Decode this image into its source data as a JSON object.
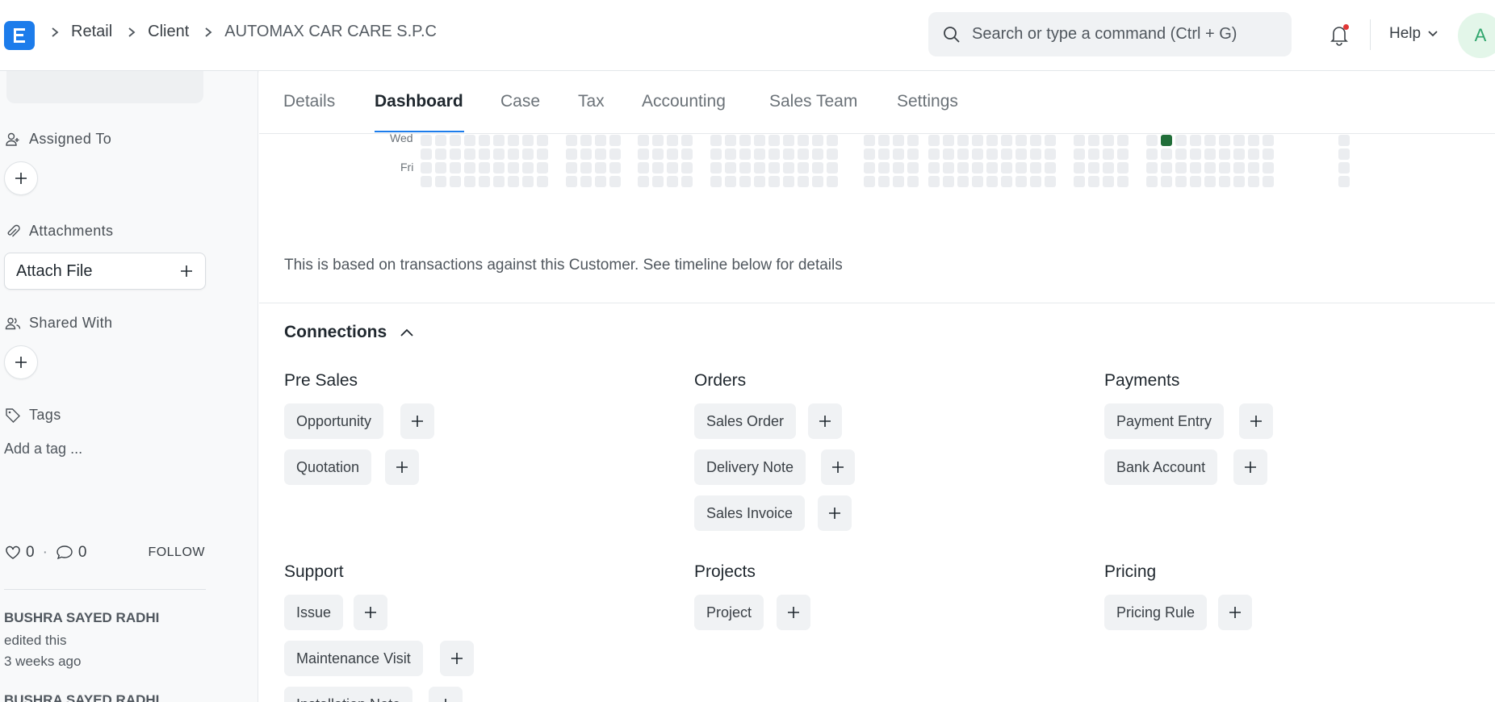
{
  "navbar": {
    "breadcrumbs": [
      "Retail",
      "Client",
      "AUTOMAX CAR CARE S.P.C"
    ],
    "search_placeholder": "Search or type a command (Ctrl + G)",
    "help_label": "Help",
    "avatar_initial": "A"
  },
  "sidebar": {
    "assigned_to": "Assigned To",
    "attachments": "Attachments",
    "attach_file": "Attach File",
    "shared_with": "Shared With",
    "tags": "Tags",
    "add_tag": "Add a tag ...",
    "likes": "0",
    "comments": "0",
    "follow": "FOLLOW",
    "activity": [
      {
        "user": "BUSHRA SAYED RADHI",
        "action": "edited this",
        "time": "3 weeks ago"
      },
      {
        "user": "BUSHRA SAYED RADHI"
      }
    ]
  },
  "tabs": [
    "Details",
    "Dashboard",
    "Case",
    "Tax",
    "Accounting",
    "Sales Team",
    "Settings"
  ],
  "active_tab": "Dashboard",
  "heatmap": {
    "day_labels": [
      "Wed",
      "Fri"
    ]
  },
  "dashboard_note": "This is based on transactions against this Customer. See timeline below for details",
  "connections": {
    "title": "Connections",
    "groups": [
      {
        "title": "Pre Sales",
        "items": [
          "Opportunity",
          "Quotation"
        ]
      },
      {
        "title": "Orders",
        "items": [
          "Sales Order",
          "Delivery Note",
          "Sales Invoice"
        ]
      },
      {
        "title": "Payments",
        "items": [
          "Payment Entry",
          "Bank Account"
        ]
      },
      {
        "title": "Support",
        "items": [
          "Issue",
          "Maintenance Visit",
          "Installation Note"
        ]
      },
      {
        "title": "Projects",
        "items": [
          "Project"
        ]
      },
      {
        "title": "Pricing",
        "items": [
          "Pricing Rule"
        ]
      }
    ]
  },
  "colors": {
    "accent": "#1c7ceb",
    "heatmap_empty": "#ebedf0",
    "heatmap_active": "#216e39"
  }
}
